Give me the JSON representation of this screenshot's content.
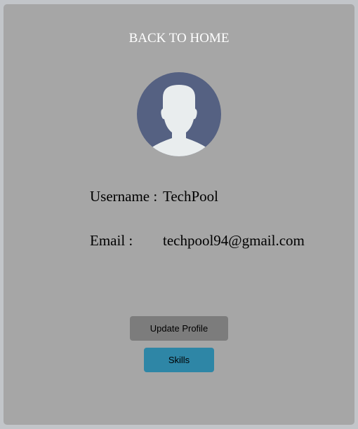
{
  "nav": {
    "back_label": "BACK TO HOME"
  },
  "avatar": {
    "icon": "user-avatar-icon",
    "bg_color": "#556182",
    "fg_color": "#e9edee"
  },
  "profile": {
    "username_label": "Username :",
    "username_value": "TechPool",
    "email_label": "Email :",
    "email_value": "techpool94@gmail.com"
  },
  "actions": {
    "update_label": "Update Profile",
    "skills_label": "Skills",
    "skills_color": "#2e86a6"
  }
}
